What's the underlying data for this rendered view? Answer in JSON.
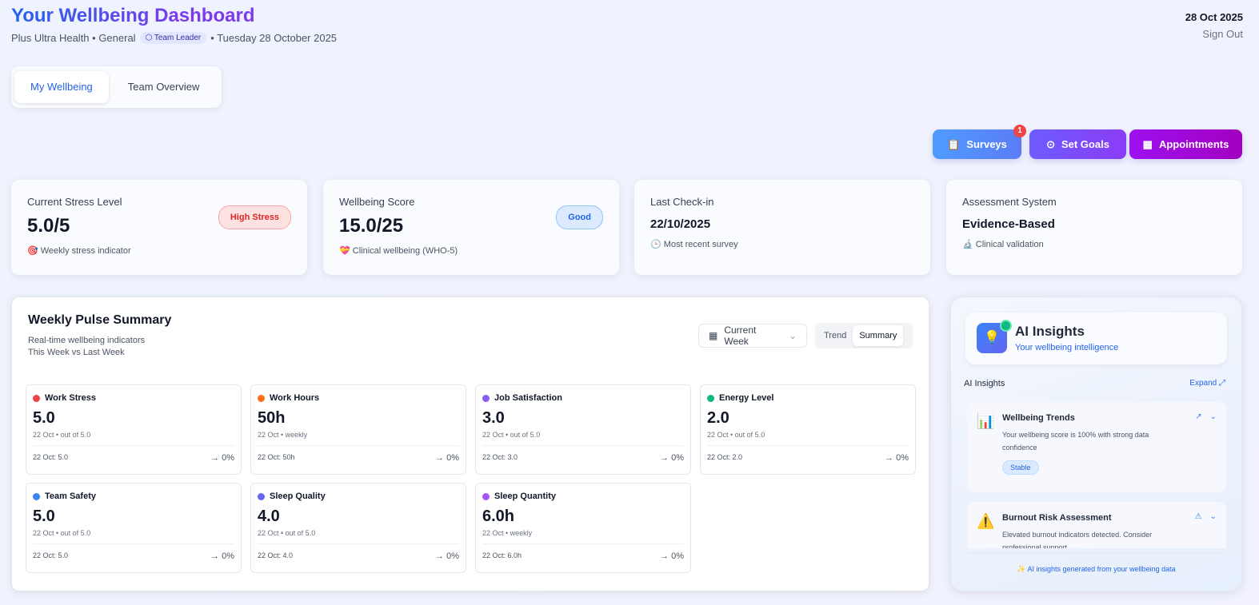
{
  "header": {
    "title": "Your Wellbeing Dashboard",
    "org": "Plus Ultra Health • General",
    "role": "Team Leader",
    "date_long": "• Tuesday 28 October 2025",
    "date_short": "28 Oct 2025",
    "sign_out": "Sign Out"
  },
  "tabs": [
    "My Wellbeing",
    "Team Overview"
  ],
  "actions": {
    "surveys": "Surveys",
    "surveys_badge": "1",
    "goals": "Set Goals",
    "appointments": "Appointments"
  },
  "stats": [
    {
      "label": "Current Stress Level",
      "value": "5.0/5",
      "note": "🎯 Weekly stress indicator",
      "pill": "High Stress"
    },
    {
      "label": "Wellbeing Score",
      "value": "15.0/25",
      "note": "💝 Clinical wellbeing (WHO-5)",
      "pill": "Good"
    },
    {
      "label": "Last Check-in",
      "value": "22/10/2025",
      "note": "🕒 Most recent survey"
    },
    {
      "label": "Assessment System",
      "value": "Evidence-Based",
      "note": "🔬 Clinical validation"
    }
  ],
  "weekly": {
    "title": "Weekly Pulse Summary",
    "subtitle": "Real-time wellbeing indicators",
    "compare": "This Week vs Last Week",
    "week_select": "Current Week",
    "toggle": [
      "Trend",
      "Summary"
    ],
    "metrics": [
      {
        "name": "Work Stress",
        "color": "#ef4444",
        "value": "5.0",
        "sub": "22 Oct • out of 5.0",
        "prev": "22 Oct: 5.0",
        "change": "→ 0%"
      },
      {
        "name": "Work Hours",
        "color": "#f97316",
        "value": "50h",
        "sub": "22 Oct • weekly",
        "prev": "22 Oct: 50h",
        "change": "→ 0%"
      },
      {
        "name": "Job Satisfaction",
        "color": "#8b5cf6",
        "value": "3.0",
        "sub": "22 Oct • out of 5.0",
        "prev": "22 Oct: 3.0",
        "change": "→ 0%"
      },
      {
        "name": "Energy Level",
        "color": "#10b981",
        "value": "2.0",
        "sub": "22 Oct • out of 5.0",
        "prev": "22 Oct: 2.0",
        "change": "→ 0%"
      },
      {
        "name": "Team Safety",
        "color": "#3b82f6",
        "value": "5.0",
        "sub": "22 Oct • out of 5.0",
        "prev": "22 Oct: 5.0",
        "change": "→ 0%"
      },
      {
        "name": "Sleep Quality",
        "color": "#6366f1",
        "value": "4.0",
        "sub": "22 Oct • out of 5.0",
        "prev": "22 Oct: 4.0",
        "change": "→ 0%"
      },
      {
        "name": "Sleep Quantity",
        "color": "#a855f7",
        "value": "6.0h",
        "sub": "22 Oct • weekly",
        "prev": "22 Oct: 6.0h",
        "change": "→ 0%"
      }
    ]
  },
  "ai": {
    "title": "AI Insights",
    "subtitle": "Your wellbeing intelligence",
    "section": "AI Insights",
    "expand": "Expand ⤢",
    "cards": [
      {
        "icon": "📊",
        "title": "Wellbeing Trends",
        "desc": "Your wellbeing score is 100% with strong data confidence",
        "tag": "Stable",
        "ctl": "↗"
      },
      {
        "icon": "⚠️",
        "title": "Burnout Risk Assessment",
        "desc": "Elevated burnout indicators detected. Consider professional support.",
        "ctl": "⚠"
      }
    ],
    "footer": "✨ AI insights generated from your wellbeing data"
  }
}
